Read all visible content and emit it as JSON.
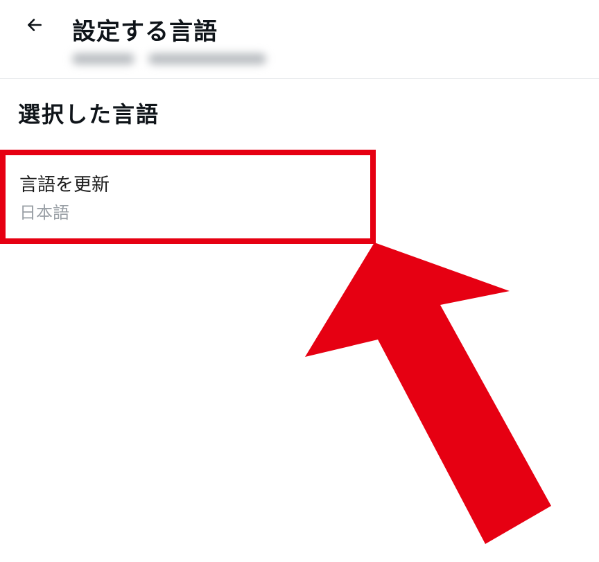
{
  "header": {
    "title": "設定する言語"
  },
  "section": {
    "heading": "選択した言語"
  },
  "languageOption": {
    "label": "言語を更新",
    "current": "日本語"
  },
  "annotation": {
    "highlightColor": "#e60012"
  }
}
